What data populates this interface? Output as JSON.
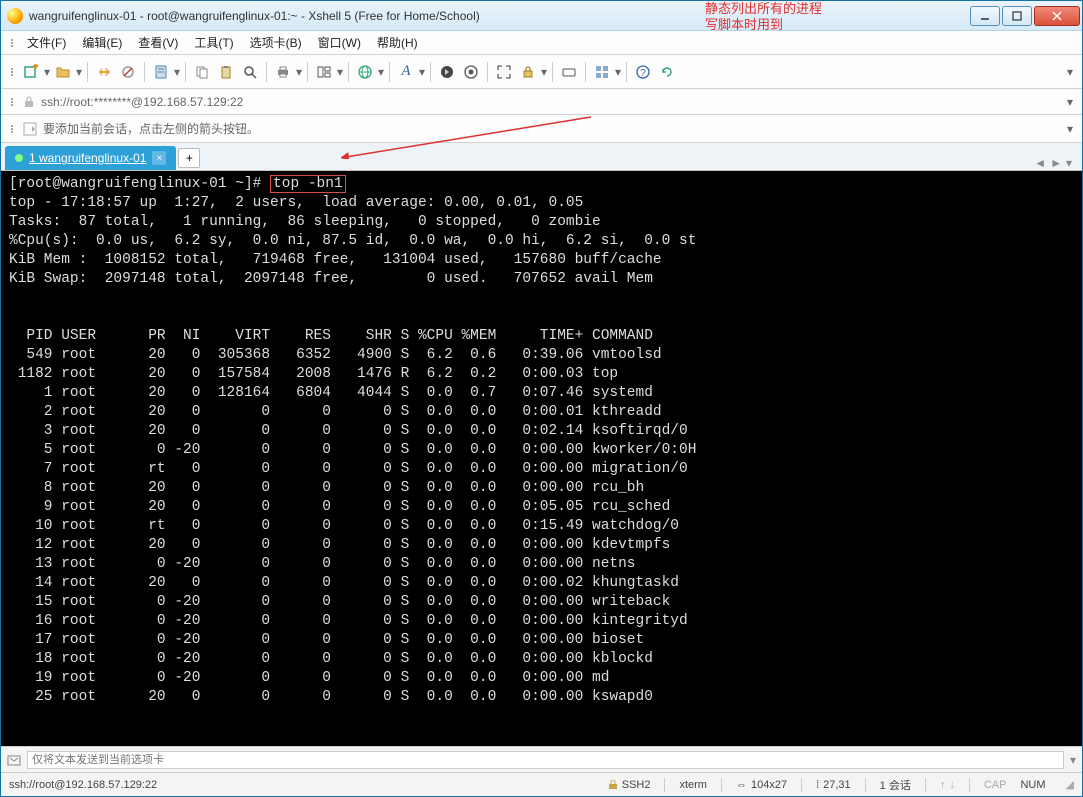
{
  "window": {
    "title": "wangruifenglinux-01 - root@wangruifenglinux-01:~ - Xshell 5 (Free for Home/School)"
  },
  "menus": [
    "文件(F)",
    "编辑(E)",
    "查看(V)",
    "工具(T)",
    "选项卡(B)",
    "窗口(W)",
    "帮助(H)"
  ],
  "address": "ssh://root:********@192.168.57.129:22",
  "hint": "要添加当前会话，点击左侧的箭头按钮。",
  "annotation": {
    "line1": "静态列出所有的进程",
    "line2": "写脚本时用到"
  },
  "tab": {
    "label": "1 wangruifenglinux-01"
  },
  "terminal": {
    "prompt": "[root@wangruifenglinux-01 ~]# ",
    "command": "top -bn1",
    "summary": [
      "top - 17:18:57 up  1:27,  2 users,  load average: 0.00, 0.01, 0.05",
      "Tasks:  87 total,   1 running,  86 sleeping,   0 stopped,   0 zombie",
      "%Cpu(s):  0.0 us,  6.2 sy,  0.0 ni, 87.5 id,  0.0 wa,  0.0 hi,  6.2 si,  0.0 st",
      "KiB Mem :  1008152 total,   719468 free,   131004 used,   157680 buff/cache",
      "KiB Swap:  2097148 total,  2097148 free,        0 used.   707652 avail Mem"
    ],
    "header": "  PID USER      PR  NI    VIRT    RES    SHR S %CPU %MEM     TIME+ COMMAND",
    "rows": [
      {
        "pid": 549,
        "user": "root",
        "pr": "20",
        "ni": "0",
        "virt": "305368",
        "res": "6352",
        "shr": "4900",
        "s": "S",
        "cpu": "6.2",
        "mem": "0.6",
        "time": "0:39.06",
        "cmd": "vmtoolsd"
      },
      {
        "pid": 1182,
        "user": "root",
        "pr": "20",
        "ni": "0",
        "virt": "157584",
        "res": "2008",
        "shr": "1476",
        "s": "R",
        "cpu": "6.2",
        "mem": "0.2",
        "time": "0:00.03",
        "cmd": "top"
      },
      {
        "pid": 1,
        "user": "root",
        "pr": "20",
        "ni": "0",
        "virt": "128164",
        "res": "6804",
        "shr": "4044",
        "s": "S",
        "cpu": "0.0",
        "mem": "0.7",
        "time": "0:07.46",
        "cmd": "systemd"
      },
      {
        "pid": 2,
        "user": "root",
        "pr": "20",
        "ni": "0",
        "virt": "0",
        "res": "0",
        "shr": "0",
        "s": "S",
        "cpu": "0.0",
        "mem": "0.0",
        "time": "0:00.01",
        "cmd": "kthreadd"
      },
      {
        "pid": 3,
        "user": "root",
        "pr": "20",
        "ni": "0",
        "virt": "0",
        "res": "0",
        "shr": "0",
        "s": "S",
        "cpu": "0.0",
        "mem": "0.0",
        "time": "0:02.14",
        "cmd": "ksoftirqd/0"
      },
      {
        "pid": 5,
        "user": "root",
        "pr": "0",
        "ni": "-20",
        "virt": "0",
        "res": "0",
        "shr": "0",
        "s": "S",
        "cpu": "0.0",
        "mem": "0.0",
        "time": "0:00.00",
        "cmd": "kworker/0:0H"
      },
      {
        "pid": 7,
        "user": "root",
        "pr": "rt",
        "ni": "0",
        "virt": "0",
        "res": "0",
        "shr": "0",
        "s": "S",
        "cpu": "0.0",
        "mem": "0.0",
        "time": "0:00.00",
        "cmd": "migration/0"
      },
      {
        "pid": 8,
        "user": "root",
        "pr": "20",
        "ni": "0",
        "virt": "0",
        "res": "0",
        "shr": "0",
        "s": "S",
        "cpu": "0.0",
        "mem": "0.0",
        "time": "0:00.00",
        "cmd": "rcu_bh"
      },
      {
        "pid": 9,
        "user": "root",
        "pr": "20",
        "ni": "0",
        "virt": "0",
        "res": "0",
        "shr": "0",
        "s": "S",
        "cpu": "0.0",
        "mem": "0.0",
        "time": "0:05.05",
        "cmd": "rcu_sched"
      },
      {
        "pid": 10,
        "user": "root",
        "pr": "rt",
        "ni": "0",
        "virt": "0",
        "res": "0",
        "shr": "0",
        "s": "S",
        "cpu": "0.0",
        "mem": "0.0",
        "time": "0:15.49",
        "cmd": "watchdog/0"
      },
      {
        "pid": 12,
        "user": "root",
        "pr": "20",
        "ni": "0",
        "virt": "0",
        "res": "0",
        "shr": "0",
        "s": "S",
        "cpu": "0.0",
        "mem": "0.0",
        "time": "0:00.00",
        "cmd": "kdevtmpfs"
      },
      {
        "pid": 13,
        "user": "root",
        "pr": "0",
        "ni": "-20",
        "virt": "0",
        "res": "0",
        "shr": "0",
        "s": "S",
        "cpu": "0.0",
        "mem": "0.0",
        "time": "0:00.00",
        "cmd": "netns"
      },
      {
        "pid": 14,
        "user": "root",
        "pr": "20",
        "ni": "0",
        "virt": "0",
        "res": "0",
        "shr": "0",
        "s": "S",
        "cpu": "0.0",
        "mem": "0.0",
        "time": "0:00.02",
        "cmd": "khungtaskd"
      },
      {
        "pid": 15,
        "user": "root",
        "pr": "0",
        "ni": "-20",
        "virt": "0",
        "res": "0",
        "shr": "0",
        "s": "S",
        "cpu": "0.0",
        "mem": "0.0",
        "time": "0:00.00",
        "cmd": "writeback"
      },
      {
        "pid": 16,
        "user": "root",
        "pr": "0",
        "ni": "-20",
        "virt": "0",
        "res": "0",
        "shr": "0",
        "s": "S",
        "cpu": "0.0",
        "mem": "0.0",
        "time": "0:00.00",
        "cmd": "kintegrityd"
      },
      {
        "pid": 17,
        "user": "root",
        "pr": "0",
        "ni": "-20",
        "virt": "0",
        "res": "0",
        "shr": "0",
        "s": "S",
        "cpu": "0.0",
        "mem": "0.0",
        "time": "0:00.00",
        "cmd": "bioset"
      },
      {
        "pid": 18,
        "user": "root",
        "pr": "0",
        "ni": "-20",
        "virt": "0",
        "res": "0",
        "shr": "0",
        "s": "S",
        "cpu": "0.0",
        "mem": "0.0",
        "time": "0:00.00",
        "cmd": "kblockd"
      },
      {
        "pid": 19,
        "user": "root",
        "pr": "0",
        "ni": "-20",
        "virt": "0",
        "res": "0",
        "shr": "0",
        "s": "S",
        "cpu": "0.0",
        "mem": "0.0",
        "time": "0:00.00",
        "cmd": "md"
      },
      {
        "pid": 25,
        "user": "root",
        "pr": "20",
        "ni": "0",
        "virt": "0",
        "res": "0",
        "shr": "0",
        "s": "S",
        "cpu": "0.0",
        "mem": "0.0",
        "time": "0:00.00",
        "cmd": "kswapd0"
      }
    ]
  },
  "inputbar": {
    "placeholder": "仅将文本发送到当前选项卡"
  },
  "status": {
    "left": "ssh://root@192.168.57.129:22",
    "ssh": "SSH2",
    "term": "xterm",
    "size": "104x27",
    "cursor": "27,31",
    "sessions": "1 会话",
    "caps": "CAP",
    "num": "NUM"
  }
}
